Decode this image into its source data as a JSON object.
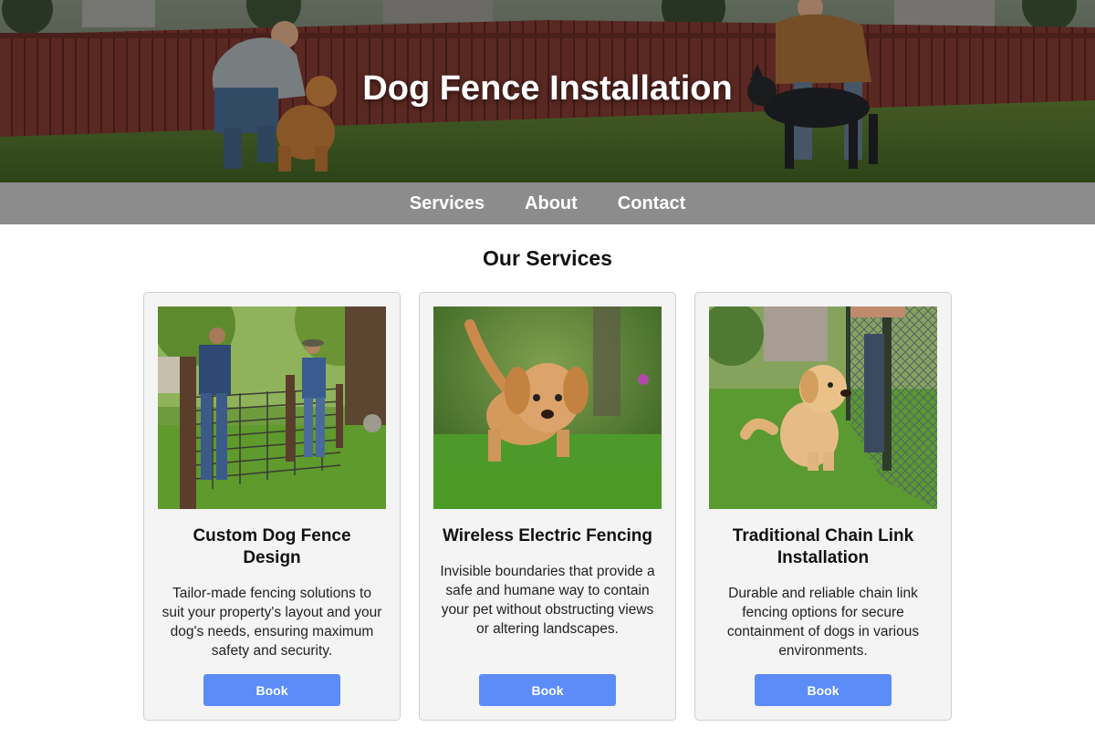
{
  "hero": {
    "title": "Dog Fence Installation",
    "image": "people-playing-with-dogs-in-fenced-backyard"
  },
  "nav": {
    "items": [
      "Services",
      "About",
      "Contact"
    ]
  },
  "services": {
    "heading": "Our Services",
    "cards": [
      {
        "image": "workers-installing-wire-fence",
        "title": "Custom Dog Fence Design",
        "description": "Tailor-made fencing solutions to suit your property's layout and your dog's needs, ensuring maximum safety and security.",
        "button": "Book"
      },
      {
        "image": "puppy-walking-on-grass",
        "title": "Wireless Electric Fencing",
        "description": "Invisible boundaries that provide a safe and humane way to contain your pet without obstructing views or altering landscapes.",
        "button": "Book"
      },
      {
        "image": "puppy-sitting-by-chain-link-fence",
        "title": "Traditional Chain Link Installation",
        "description": "Durable and reliable chain link fencing options for secure containment of dogs in various environments.",
        "button": "Book"
      }
    ]
  },
  "colors": {
    "nav_bg": "#8c8c8c",
    "button_bg": "#5b8cf7",
    "card_bg": "#f4f4f4"
  }
}
